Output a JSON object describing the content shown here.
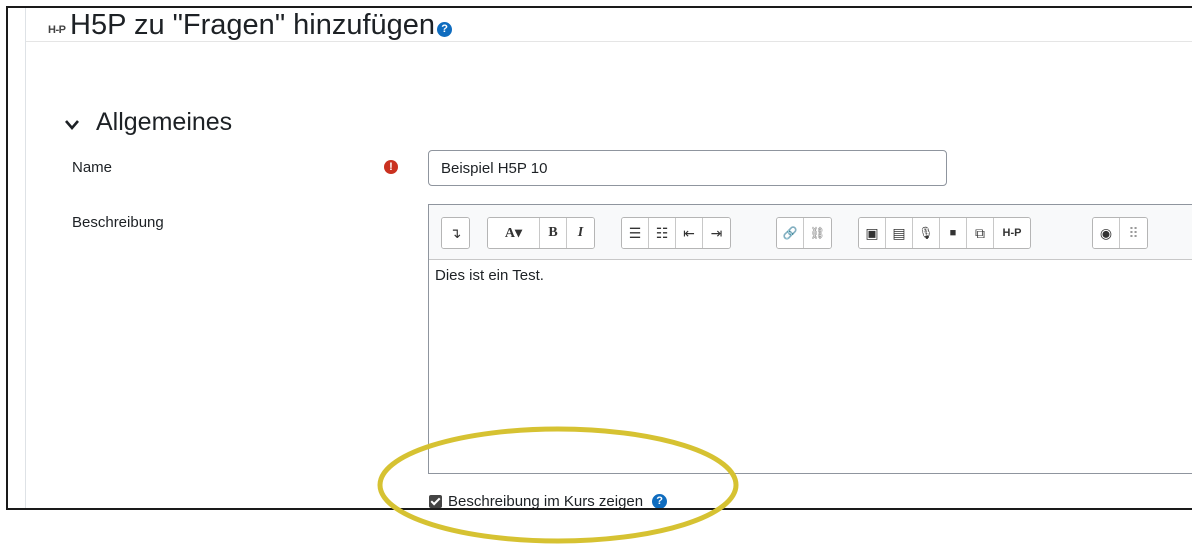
{
  "page": {
    "logo_text": "H-P",
    "title": "H5P zu \"Fragen\" hinzufügen",
    "title_help_glyph": "?"
  },
  "section": {
    "title": "Allgemeines"
  },
  "form": {
    "name_label": "Name",
    "name_required_glyph": "!",
    "name_value": "Beispiel H5P 10",
    "description_label": "Beschreibung",
    "description_content": "Dies ist ein Test.",
    "show_description_label": "Beschreibung im Kurs zeigen",
    "show_description_checked": true,
    "show_description_help_glyph": "?"
  },
  "toolbar": {
    "groups": [
      [
        {
          "icon": "collapse-icon",
          "glyph": "↴"
        }
      ],
      [
        {
          "icon": "font-style-icon",
          "glyph": "A▾"
        },
        {
          "icon": "bold-icon",
          "glyph": "B"
        },
        {
          "icon": "italic-icon",
          "glyph": "I"
        }
      ],
      [
        {
          "icon": "unordered-list-icon",
          "glyph": "☰"
        },
        {
          "icon": "ordered-list-icon",
          "glyph": "☷"
        },
        {
          "icon": "outdent-icon",
          "glyph": "⇤"
        },
        {
          "icon": "indent-icon",
          "glyph": "⇥"
        }
      ],
      [
        {
          "icon": "link-icon",
          "glyph": "🔗"
        },
        {
          "icon": "unlink-icon",
          "glyph": "⛓"
        }
      ],
      [
        {
          "icon": "image-icon",
          "glyph": "▣"
        },
        {
          "icon": "media-icon",
          "glyph": "▤"
        },
        {
          "icon": "record-audio-icon",
          "glyph": "🎙"
        },
        {
          "icon": "record-video-icon",
          "glyph": "■"
        },
        {
          "icon": "manage-files-icon",
          "glyph": "⧉"
        },
        {
          "icon": "h5p-icon",
          "glyph": "H-P"
        }
      ],
      [
        {
          "icon": "accessibility-checker-icon",
          "glyph": "◉"
        },
        {
          "icon": "screenreader-helper-icon",
          "glyph": "⠿"
        }
      ]
    ]
  },
  "colors": {
    "required": "#ca3120",
    "help": "#0f6cbf",
    "highlight": "#d6c232"
  }
}
